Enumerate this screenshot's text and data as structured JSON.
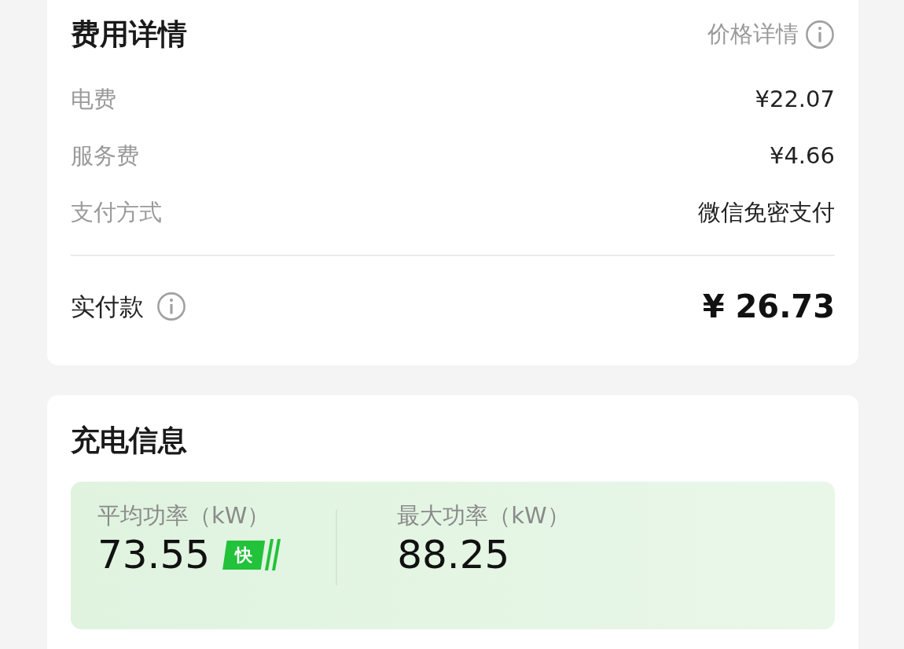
{
  "fee_card": {
    "title": "费用详情",
    "price_details_link": "价格详情",
    "rows": [
      {
        "label": "电费",
        "value": "¥22.07"
      },
      {
        "label": "服务费",
        "value": "¥4.66"
      },
      {
        "label": "支付方式",
        "value": "微信免密支付"
      }
    ],
    "total": {
      "label": "实付款",
      "value": "¥ 26.73"
    }
  },
  "charging_card": {
    "title": "充电信息",
    "metrics": [
      {
        "label": "平均功率（kW）",
        "value": "73.55",
        "badge": "快"
      },
      {
        "label": "最大功率（kW）",
        "value": "88.25"
      }
    ]
  }
}
